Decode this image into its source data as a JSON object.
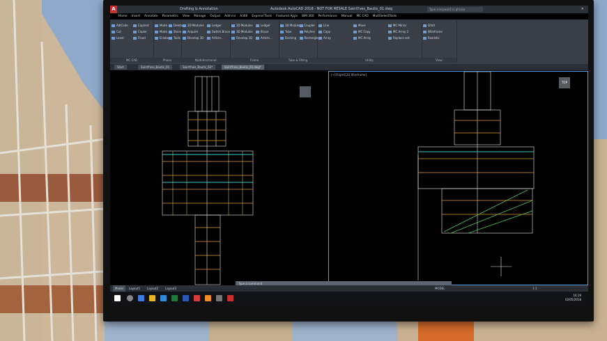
{
  "window": {
    "title": "Autodesk AutoCAD 2018 - NOT FOR RESALE   SaintYves_Bautis_01.dwg",
    "search_placeholder": "Type a keyword or phrase",
    "workspace": "Drafting & Annotation",
    "app_logo": "A"
  },
  "ribbon_tabs": [
    "Home",
    "Insert",
    "Annotate",
    "Parametric",
    "View",
    "Manage",
    "Output",
    "Add-ins",
    "A360",
    "Express Tools",
    "Featured Apps",
    "BIM 360",
    "Performance",
    "Manual",
    "MC CAD",
    "MultiSelectTools"
  ],
  "panels": [
    {
      "title": "MC CAD",
      "tools": [
        "AltiCode",
        "Cut",
        "Level",
        "Copinot",
        "Copier",
        "Flood"
      ]
    },
    {
      "title": "Phase",
      "tools": [
        "Mode",
        "Mode",
        "Eclobo",
        "Delete",
        "Stairs",
        "Tools"
      ]
    },
    {
      "title": "Multidirectional",
      "tools": [
        "2D Modules",
        "Acquire",
        "Develop 3D",
        "Ledger",
        "Switch Brace",
        "Article..."
      ]
    },
    {
      "title": "Frame",
      "tools": [
        "2D Modules",
        "3D Modules",
        "Develop 3D",
        "Ledger",
        "Brace",
        "Article..."
      ]
    },
    {
      "title": "Tube & Fitting",
      "tools": [
        "3D Modules",
        "Tube",
        "Docking",
        "Coupler",
        "Polyline",
        "Rectangle"
      ]
    },
    {
      "title": "Utility",
      "tools": [
        "Line",
        "Copy",
        "Array",
        "Move",
        "MC Copy",
        "MC Array",
        "MC Mirror",
        "MC Array 2",
        "Replace ent."
      ]
    },
    {
      "title": "View",
      "tools": [
        "Orbit",
        "Wireframe",
        "Realistic"
      ]
    }
  ],
  "file_tabs": [
    "Start",
    "SaintYves_Bautis_01",
    "SaintYves_Bautis_02*",
    "SaintYves_Bautis_01.dwg*"
  ],
  "viewports": {
    "right_label": "[+][Right][2D Wireframe]",
    "viewcube_left": "",
    "viewcube_right": "TOP"
  },
  "command_line": {
    "placeholder": "Type a command"
  },
  "layout_tabs": [
    "Model",
    "Layout1",
    "Layout2",
    "Layout3"
  ],
  "status": {
    "mode": "MODEL",
    "scale": "1:1"
  },
  "clock": {
    "time": "16:19",
    "date": "02/05/2018"
  },
  "colors": {
    "scaffold_white": "#e8e8e8",
    "scaffold_orange": "#e49a3c",
    "scaffold_cyan": "#3fc7c7",
    "scaffold_green": "#54c454",
    "ribbon": "#3a3f47",
    "selection_blue": "#5aa0e0"
  }
}
